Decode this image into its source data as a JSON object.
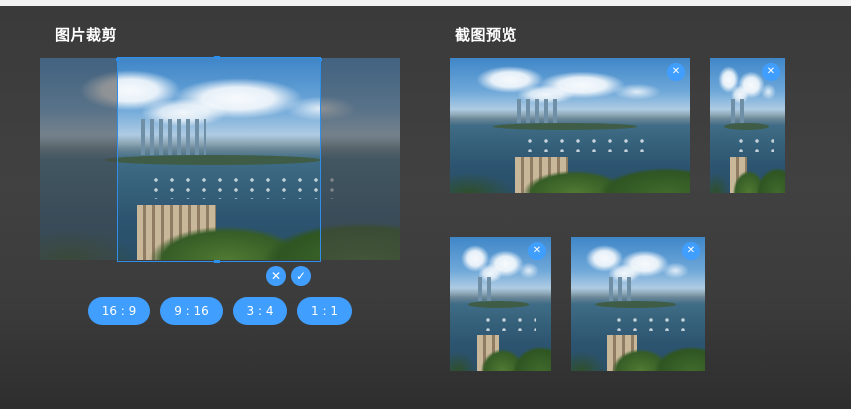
{
  "cropper": {
    "title": "图片裁剪",
    "cancel_icon": "✕",
    "confirm_icon": "✓",
    "ratios": [
      "16 : 9",
      "9 : 16",
      "3 : 4",
      "1 : 1"
    ]
  },
  "preview": {
    "title": "截图预览",
    "remove_icon": "✕"
  },
  "colors": {
    "accent": "#409eff",
    "crop_border": "#2f8fe8"
  }
}
